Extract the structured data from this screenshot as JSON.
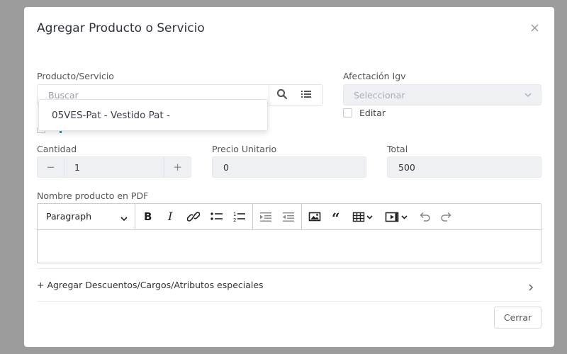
{
  "modal": {
    "title": "Agregar Producto o Servicio",
    "close_glyph": "×"
  },
  "producto": {
    "label": "Producto/Servicio",
    "placeholder": "Buscar",
    "dropdown_item": "05VES-Pat - Vestido Pat -"
  },
  "afectacion": {
    "label": "Afectación Igv",
    "placeholder": "Seleccionar",
    "checkbox_label": "Editar"
  },
  "cantidad": {
    "label": "Cantidad",
    "value": "1",
    "minus": "−",
    "plus": "+"
  },
  "precio": {
    "label": "Precio Unitario",
    "value": "0"
  },
  "total": {
    "label": "Total",
    "value": "500"
  },
  "pdf": {
    "label": "Nombre producto en PDF",
    "paragraph_select": "Paragraph"
  },
  "accordion": {
    "label": "+ Agregar Descuentos/Cargos/Atributos especiales"
  },
  "footer": {
    "close_button": "Cerrar"
  },
  "colors": {
    "accent": "#2a8fbd",
    "border": "#dfe3e8",
    "field_bg": "#eef0f3"
  }
}
